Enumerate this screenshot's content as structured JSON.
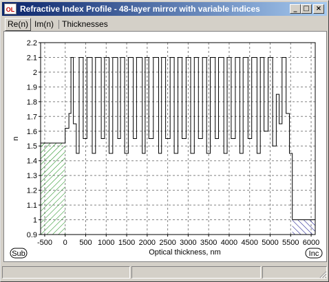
{
  "window": {
    "title": "Refractive Index Profile - 48-layer mirror with variable indices",
    "icon_text": "OL",
    "controls": {
      "minimize": "_",
      "maximize": "□",
      "close": "×"
    }
  },
  "tabs": [
    {
      "label": "Re(n)",
      "active": true
    },
    {
      "label": "Im(n)",
      "active": false
    },
    {
      "label": "Thicknesses",
      "active": false
    }
  ],
  "chart_data": {
    "type": "line",
    "xlabel": "Optical thickness, nm",
    "ylabel": "n",
    "xlim": [
      -600,
      6100
    ],
    "ylim": [
      0.9,
      2.2
    ],
    "x_ticks": [
      -500,
      0,
      500,
      1000,
      1500,
      2000,
      2500,
      3000,
      3500,
      4000,
      4500,
      5000,
      5500,
      6000
    ],
    "y_ticks": [
      0.9,
      1,
      1.1,
      1.2,
      1.3,
      1.4,
      1.5,
      1.6,
      1.7,
      1.8,
      1.9,
      2,
      2.1,
      2.2
    ],
    "grid": true,
    "substrate": {
      "label": "Sub",
      "x": [
        -600,
        0
      ],
      "n": 1.52,
      "hatch": "green"
    },
    "incident": {
      "label": "Inc",
      "x": [
        5540,
        6100
      ],
      "n": 1.0,
      "hatch": "blue"
    },
    "profile": {
      "x": [
        0,
        0,
        90,
        90,
        140,
        140,
        200,
        200,
        270,
        270,
        340,
        340,
        440,
        440,
        530,
        530,
        660,
        660,
        740,
        740,
        880,
        880,
        960,
        960,
        1070,
        1070,
        1160,
        1160,
        1280,
        1280,
        1350,
        1350,
        1450,
        1450,
        1540,
        1540,
        1660,
        1660,
        1740,
        1740,
        1880,
        1880,
        1950,
        1950,
        2040,
        2040,
        2150,
        2150,
        2280,
        2280,
        2350,
        2350,
        2450,
        2450,
        2560,
        2560,
        2660,
        2660,
        2750,
        2750,
        2850,
        2850,
        2950,
        2950,
        3060,
        3060,
        3150,
        3150,
        3250,
        3250,
        3350,
        3350,
        3450,
        3450,
        3540,
        3540,
        3660,
        3660,
        3740,
        3740,
        3870,
        3870,
        3950,
        3950,
        4050,
        4050,
        4150,
        4150,
        4260,
        4260,
        4340,
        4340,
        4460,
        4460,
        4550,
        4550,
        4680,
        4680,
        4760,
        4760,
        4850,
        4850,
        4950,
        4950,
        5060,
        5060,
        5150,
        5150,
        5220,
        5220,
        5290,
        5290,
        5390,
        5390,
        5470,
        5470,
        5540,
        5540
      ],
      "n": [
        1.52,
        1.62,
        1.62,
        1.72,
        1.72,
        2.1,
        2.1,
        1.65,
        1.65,
        1.45,
        1.45,
        2.1,
        2.1,
        1.55,
        1.55,
        2.1,
        2.1,
        1.45,
        1.45,
        2.1,
        2.1,
        1.55,
        1.55,
        2.1,
        2.1,
        1.45,
        1.45,
        2.1,
        2.1,
        1.55,
        1.55,
        2.1,
        2.1,
        1.45,
        1.45,
        2.1,
        2.1,
        1.55,
        1.55,
        2.1,
        2.1,
        1.45,
        1.45,
        2.1,
        2.1,
        1.55,
        1.55,
        2.1,
        2.1,
        1.45,
        1.45,
        2.1,
        2.1,
        1.55,
        1.55,
        2.1,
        2.1,
        1.45,
        1.45,
        2.1,
        2.1,
        1.55,
        1.55,
        2.1,
        2.1,
        1.45,
        1.45,
        2.1,
        2.1,
        1.55,
        1.55,
        2.1,
        2.1,
        1.45,
        1.45,
        2.1,
        2.1,
        1.55,
        1.55,
        2.1,
        2.1,
        1.45,
        1.45,
        2.1,
        2.1,
        1.55,
        1.55,
        2.1,
        2.1,
        1.45,
        1.45,
        2.1,
        2.1,
        1.55,
        1.55,
        2.1,
        2.1,
        1.45,
        1.45,
        2.1,
        2.1,
        1.6,
        1.6,
        2.1,
        2.1,
        1.5,
        1.5,
        1.85,
        1.85,
        1.65,
        1.65,
        2.1,
        2.1,
        1.72,
        1.72,
        1.45,
        1.45,
        1.0
      ]
    }
  },
  "status": {
    "panels": [
      "",
      "",
      ""
    ]
  }
}
